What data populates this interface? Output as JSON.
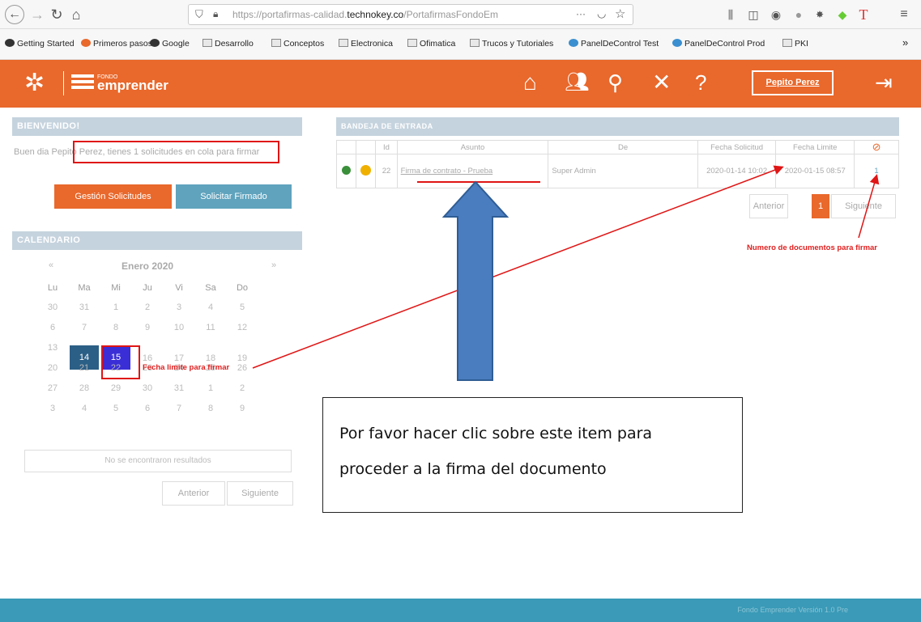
{
  "browser": {
    "url_prefix": "https://portafirmas-calidad.",
    "url_domain": "technokey.co",
    "url_suffix": "/PortafirmasFondoEm",
    "more_dots": "···",
    "bookmarks": [
      "Getting Started",
      "Primeros pasos",
      "Google",
      "Desarrollo",
      "Conceptos",
      "Electronica",
      "Ofimatica",
      "Trucos y Tutoriales",
      "PanelDeControl Test",
      "PanelDeControl Prod",
      "PKI"
    ],
    "overflow": "»"
  },
  "header": {
    "logo_small": "FONDO",
    "logo_text": "emprender",
    "user_name": "Pepito Perez"
  },
  "welcome": {
    "title": "BIENVENIDO!",
    "text": "Buen dia Pepito Perez, tienes 1 solicitudes en cola para firmar",
    "btn_manage": "Gestión Solicitudes",
    "btn_request": "Solicitar Firmado"
  },
  "calendar": {
    "title": "CALENDARIO",
    "month": "Enero 2020",
    "prev": "«",
    "next": "»",
    "weekdays": [
      "Lu",
      "Ma",
      "Mi",
      "Ju",
      "Vi",
      "Sa",
      "Do"
    ],
    "weeks": [
      [
        "30",
        "31",
        "1",
        "2",
        "3",
        "4",
        "5"
      ],
      [
        "6",
        "7",
        "8",
        "9",
        "10",
        "11",
        "12"
      ],
      [
        "13",
        "14",
        "15",
        "16",
        "17",
        "18",
        "19"
      ],
      [
        "20",
        "21",
        "22",
        "23",
        "24",
        "25",
        "26"
      ],
      [
        "27",
        "28",
        "29",
        "30",
        "31",
        "1",
        "2"
      ],
      [
        "3",
        "4",
        "5",
        "6",
        "7",
        "8",
        "9"
      ]
    ],
    "no_results": "No se encontraron resultados",
    "prev_btn": "Anterior",
    "next_btn": "Siguiente"
  },
  "inbox": {
    "title": "BANDEJA DE ENTRADA",
    "headers": [
      "",
      "",
      "Id",
      "Asunto",
      "De",
      "Fecha Solicitud",
      "Fecha Limite",
      ""
    ],
    "row": {
      "id": "22",
      "subject": "Firma de contrato - Prueba",
      "from": "Super Admin",
      "request_date": "2020-01-14 10:02",
      "limit_date": "2020-01-15 08:57",
      "docs": "1"
    },
    "prev_btn": "Anterior",
    "page": "1",
    "next_btn": "Siguiente"
  },
  "annotations": {
    "docs_count": "Numero de documentos para firmar",
    "limit_date": "Fecha limite para firmar",
    "callout_line1": "Por favor hacer clic sobre este item para",
    "callout_line2": "proceder a la firma del documento"
  },
  "footer": {
    "text": "Fondo Emprender Versión 1.0 Pre"
  },
  "colors": {
    "header": "#e9682b",
    "accent_blue": "#4a8fae",
    "footer": "#3a9ab7",
    "annotation_red": "#e01515"
  }
}
